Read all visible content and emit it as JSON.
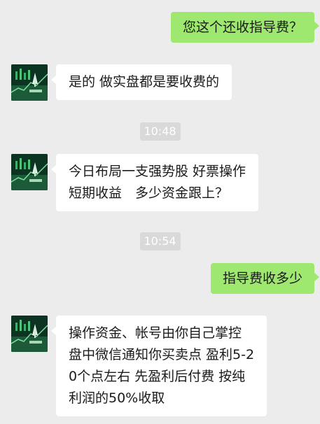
{
  "chat": {
    "messages": [
      {
        "side": "out",
        "text": "您这个还收指导费？"
      },
      {
        "side": "in",
        "text": "是的 做实盘都是要收费的"
      },
      {
        "time": "10:48"
      },
      {
        "side": "in",
        "lines": [
          "今日布局一支强势股 好票操作",
          "短期收益　多少资金跟上？"
        ]
      },
      {
        "time": "10:54"
      },
      {
        "side": "out",
        "text": "指导费收多少"
      },
      {
        "side": "in",
        "lines": [
          "操作资金、帐号由你自己掌控",
          "盘中微信通知你买卖点 盈利5-2",
          "0个点左右 先盈利后付费 按纯",
          "利润的50%收取"
        ]
      }
    ]
  },
  "colors": {
    "background": "#ececec",
    "outgoing_bubble": "#9ee870",
    "incoming_bubble": "#ffffff",
    "timestamp_bg": "#d9d9d9"
  },
  "icons": {
    "avatar": "stock-chart-avatar-icon"
  }
}
